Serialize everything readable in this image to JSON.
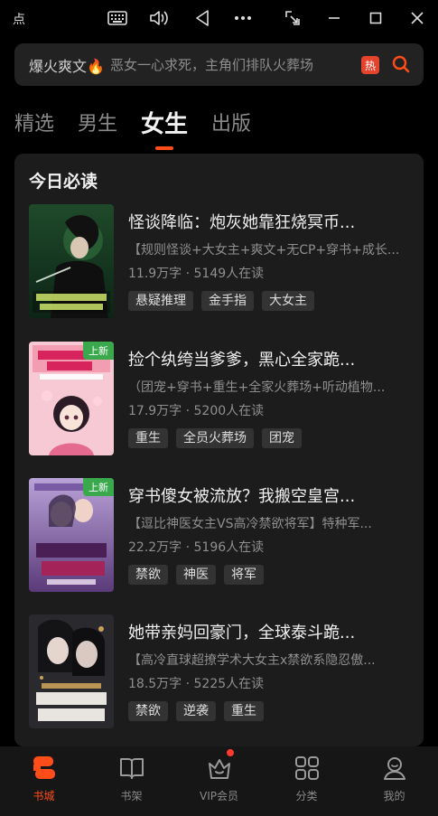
{
  "window": {
    "title": "点",
    "icons": [
      "keyboard-icon",
      "volume-icon",
      "back-icon",
      "more-icon",
      "screenshot-icon",
      "minimize-icon",
      "maximize-icon",
      "close-icon"
    ]
  },
  "search": {
    "hot_keyword": "爆火爽文🔥",
    "placeholder": "恶女一心求死，主角们排队火葬场",
    "hot_badge": "热"
  },
  "tabs": [
    {
      "label": "精选",
      "active": false
    },
    {
      "label": "男生",
      "active": false
    },
    {
      "label": "女生",
      "active": true
    },
    {
      "label": "出版",
      "active": false
    }
  ],
  "section": {
    "title": "今日必读",
    "books": [
      {
        "title": "怪谈降临：炮灰她靠狂烧冥币...",
        "desc": "【规则怪谈+大女主+爽文+无CP+穿书+成长...",
        "meta": "11.9万字 · 5149人在读",
        "badge": "",
        "tags": [
          "悬疑推理",
          "金手指",
          "大女主"
        ]
      },
      {
        "title": "捡个纨绔当爹爹，黑心全家跪...",
        "desc": "（团宠+穿书+重生+全家火葬场+听动植物...",
        "meta": "17.9万字 · 5200人在读",
        "badge": "上新",
        "tags": [
          "重生",
          "全员火葬场",
          "团宠"
        ]
      },
      {
        "title": "穿书傻女被流放？我搬空皇宫...",
        "desc": "【逗比神医女主VS高冷禁欲将军】特种军...",
        "meta": "22.2万字 · 5196人在读",
        "badge": "上新",
        "tags": [
          "禁欲",
          "神医",
          "将军"
        ]
      },
      {
        "title": "她带亲妈回豪门，全球泰斗跪...",
        "desc": "【高冷直球超撩学术大女主x禁欲系隐忍傲...",
        "meta": "18.5万字 · 5225人在读",
        "badge": "",
        "tags": [
          "禁欲",
          "逆袭",
          "重生"
        ]
      }
    ]
  },
  "bottom_nav": [
    {
      "label": "书城",
      "icon": "bookstore-icon",
      "active": true
    },
    {
      "label": "书架",
      "icon": "bookshelf-icon",
      "active": false
    },
    {
      "label": "VIP会员",
      "icon": "vip-crown-icon",
      "active": false,
      "dot": true
    },
    {
      "label": "分类",
      "icon": "category-grid-icon",
      "active": false
    },
    {
      "label": "我的",
      "icon": "profile-icon",
      "active": false
    }
  ],
  "colors": {
    "accent": "#ff4d1a",
    "new_badge": "#3aa84d",
    "hot_badge": "#e5432b"
  }
}
